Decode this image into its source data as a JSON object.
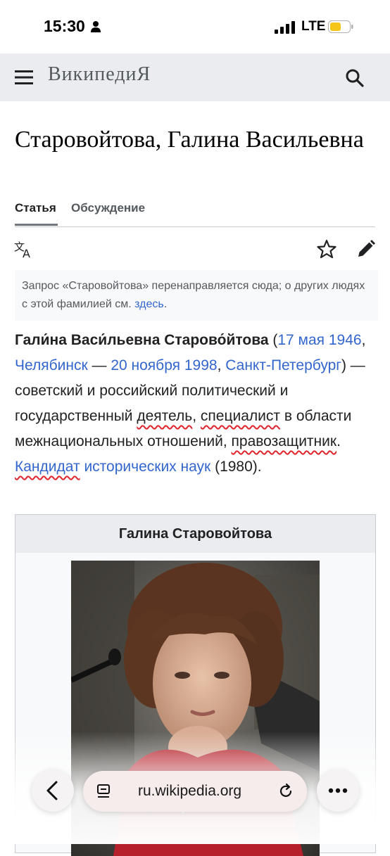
{
  "status_bar": {
    "time": "15:30",
    "network": "LTE"
  },
  "header": {
    "logo_text": "ВикипедиЯ"
  },
  "article": {
    "title": "Старовойтова, Галина Васильевна",
    "tabs": [
      {
        "label": "Статья",
        "active": true
      },
      {
        "label": "Обсуждение",
        "active": false
      }
    ],
    "hatnote": {
      "text": "Запрос «Старовойтова» перенаправляется сюда; о других людях с этой фамилией см. ",
      "link": "здесь",
      "end": "."
    },
    "lead": {
      "name": "Гали́на Васи́льевна Старово́йтова",
      "open_paren": " (",
      "birth_date": "17 мая 1946",
      "comma1": ", ",
      "birth_place": "Челябинск",
      "dash": " — ",
      "death_date": "20 ноября 1998",
      "comma2": ", ",
      "death_place": "Санкт-Петербург",
      "text1": ") — советский и российский политический и государственный ",
      "word_deyatel": "деятель",
      "comma3": ", ",
      "word_specialist": "специалист",
      "text2": " в области межнациональных отношений, ",
      "word_pravo": "правозащитник",
      "period": ". ",
      "word_kandidat": "Кандидат",
      "space": " ",
      "link_nauk": "исторических наук",
      "end": " (1980)."
    },
    "infobox": {
      "title": "Галина Старовойтова"
    }
  },
  "browser_bar": {
    "url": "ru.wikipedia.org"
  },
  "colors": {
    "link": "#3366cc",
    "header_bg": "#eaecf0",
    "spell_underline": "#e0242c"
  }
}
